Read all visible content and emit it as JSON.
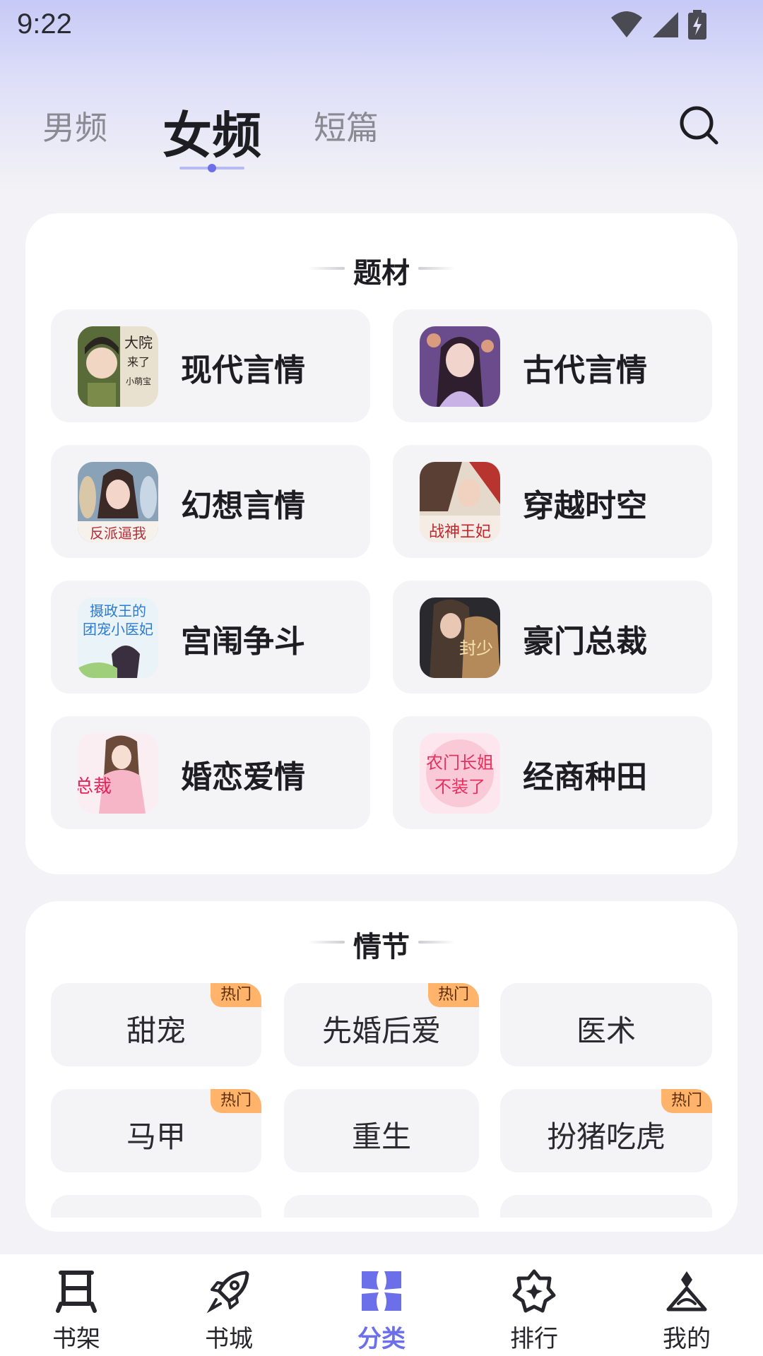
{
  "status_bar": {
    "time": "9:22"
  },
  "top_tabs": [
    {
      "label": "男频"
    },
    {
      "label": "女频"
    },
    {
      "label": "短篇"
    }
  ],
  "active_top_tab": "女频",
  "theme_section": {
    "title": "题材",
    "items": [
      {
        "label": "现代言情",
        "cover_text": "大院来了个带空间的小萌宝"
      },
      {
        "label": "古代言情",
        "cover_text": ""
      },
      {
        "label": "幻想言情",
        "cover_text": "反派逼我"
      },
      {
        "label": "穿越时空",
        "cover_text": "摄政王的战神王妃"
      },
      {
        "label": "宫闱争斗",
        "cover_text": "摄政王的团宠小医妃"
      },
      {
        "label": "豪门总裁",
        "cover_text": "封少"
      },
      {
        "label": "婚恋爱情",
        "cover_text": "总裁 萌妻太可口"
      },
      {
        "label": "经商种田",
        "cover_text": "农门长姐不装了"
      }
    ]
  },
  "plot_section": {
    "title": "情节",
    "items": [
      {
        "label": "甜宠",
        "badge": "热门"
      },
      {
        "label": "先婚后爱",
        "badge": "热门"
      },
      {
        "label": "医术",
        "badge": ""
      },
      {
        "label": "马甲",
        "badge": "热门"
      },
      {
        "label": "重生",
        "badge": ""
      },
      {
        "label": "扮猪吃虎",
        "badge": "热门"
      }
    ]
  },
  "bottom_nav": [
    {
      "label": "书架",
      "icon": "bookshelf-icon"
    },
    {
      "label": "书城",
      "icon": "rocket-icon"
    },
    {
      "label": "分类",
      "icon": "category-icon"
    },
    {
      "label": "排行",
      "icon": "ranking-icon"
    },
    {
      "label": "我的",
      "icon": "profile-icon"
    }
  ],
  "active_nav": "分类",
  "colors": {
    "accent": "#6b70ea",
    "hot_badge": "#ffb36b",
    "header_gradient_top": "#c7c9f6"
  }
}
